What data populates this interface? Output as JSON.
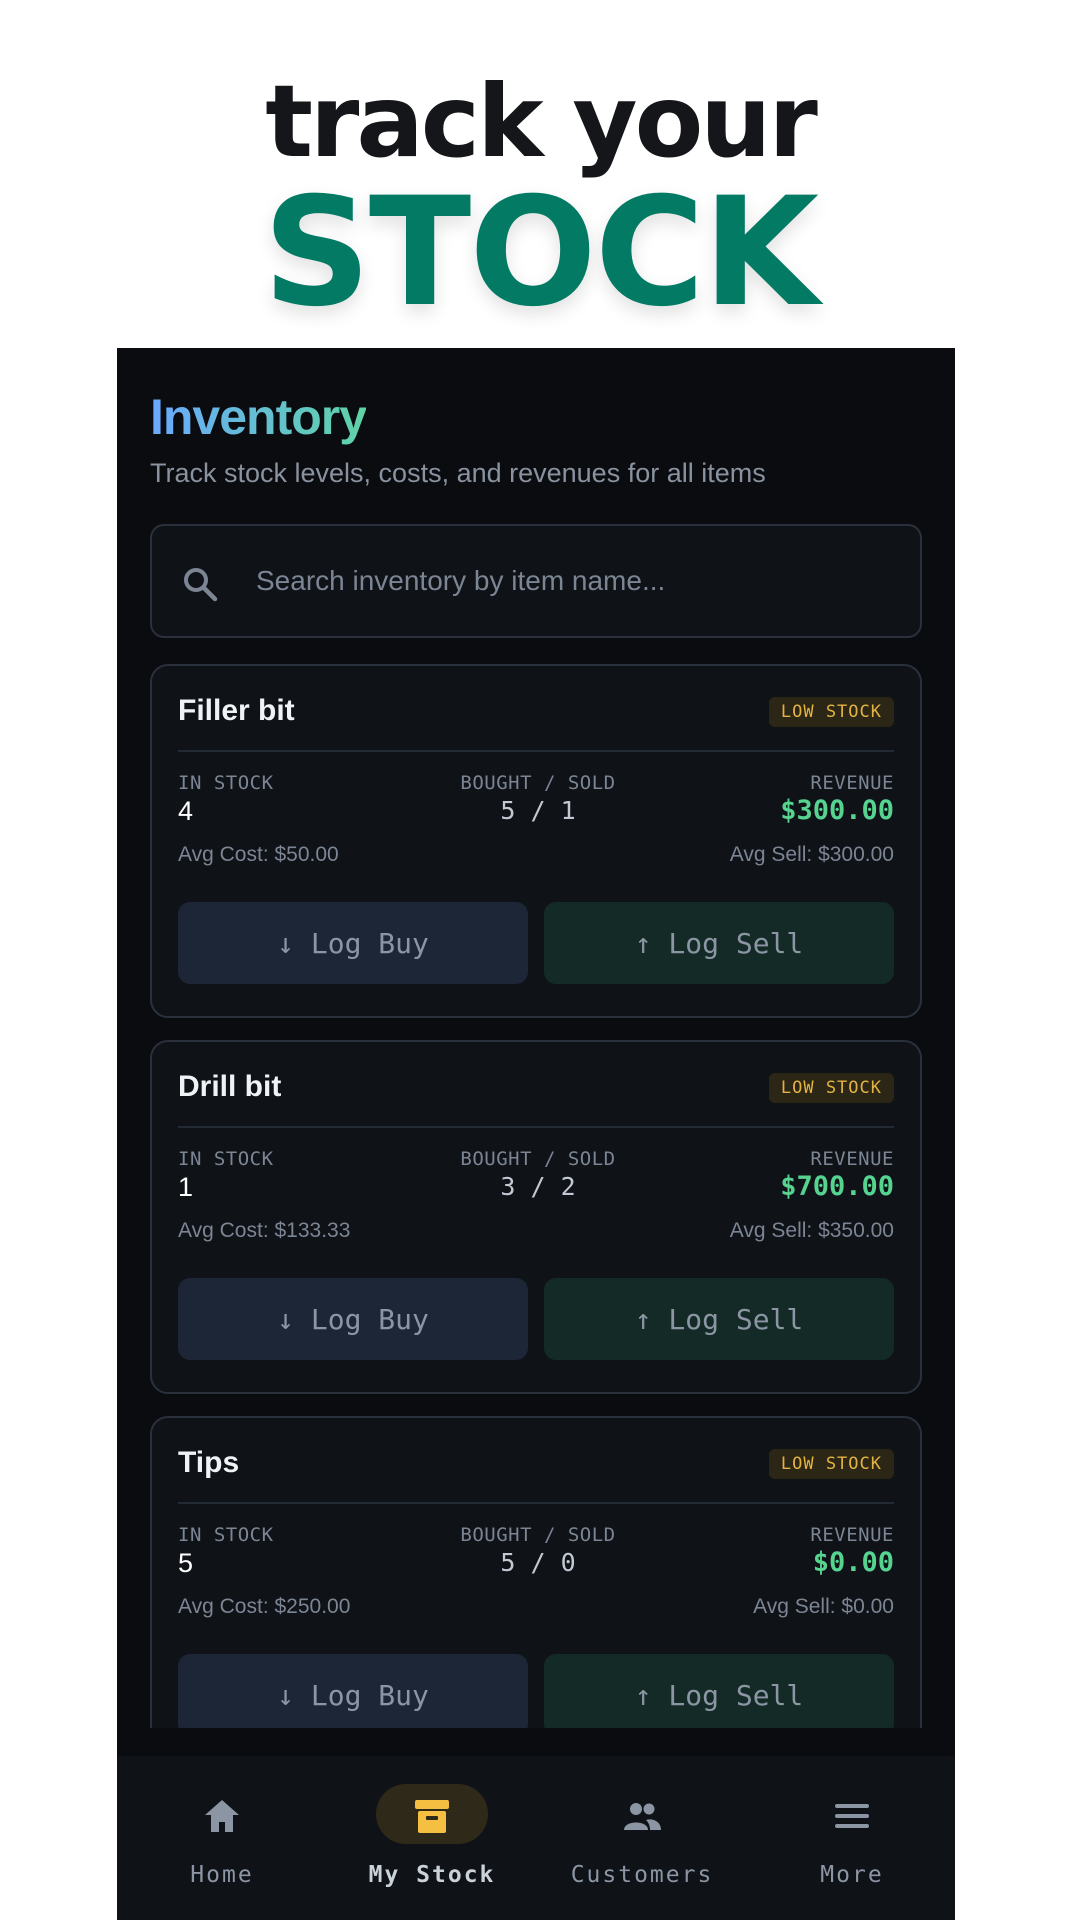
{
  "hero": {
    "line1": "track your",
    "line2": "STOCK"
  },
  "header": {
    "title": "Inventory",
    "subtitle": "Track stock levels, costs, and revenues for all items"
  },
  "search": {
    "placeholder": "Search inventory by item name...",
    "value": "",
    "icon": "search-icon"
  },
  "labels": {
    "in_stock": "IN STOCK",
    "bought_sold": "BOUGHT / SOLD",
    "revenue": "REVENUE",
    "log_buy": "↓ Log Buy",
    "log_sell": "↑ Log Sell"
  },
  "items": [
    {
      "name": "Filler bit",
      "badge": "LOW STOCK",
      "in_stock": "4",
      "bought_sold": "5 / 1",
      "revenue": "$300.00",
      "avg_cost": "Avg Cost: $50.00",
      "avg_sell": "Avg Sell: $300.00"
    },
    {
      "name": "Drill bit",
      "badge": "LOW STOCK",
      "in_stock": "1",
      "bought_sold": "3 / 2",
      "revenue": "$700.00",
      "avg_cost": "Avg Cost: $133.33",
      "avg_sell": "Avg Sell: $350.00"
    },
    {
      "name": "Tips",
      "badge": "LOW STOCK",
      "in_stock": "5",
      "bought_sold": "5 / 0",
      "revenue": "$0.00",
      "avg_cost": "Avg Cost: $250.00",
      "avg_sell": "Avg Sell: $0.00"
    }
  ],
  "nav": [
    {
      "label": "Home",
      "icon": "home-icon",
      "active": false
    },
    {
      "label": "My Stock",
      "icon": "archive-box-icon",
      "active": true
    },
    {
      "label": "Customers",
      "icon": "people-icon",
      "active": false
    },
    {
      "label": "More",
      "icon": "menu-icon",
      "active": false
    }
  ],
  "colors": {
    "accent_green": "#037a64",
    "revenue_green": "#56d38f",
    "badge_yellow": "#e3b341",
    "active_nav": "#f5c042",
    "background": "#0a0c10"
  }
}
